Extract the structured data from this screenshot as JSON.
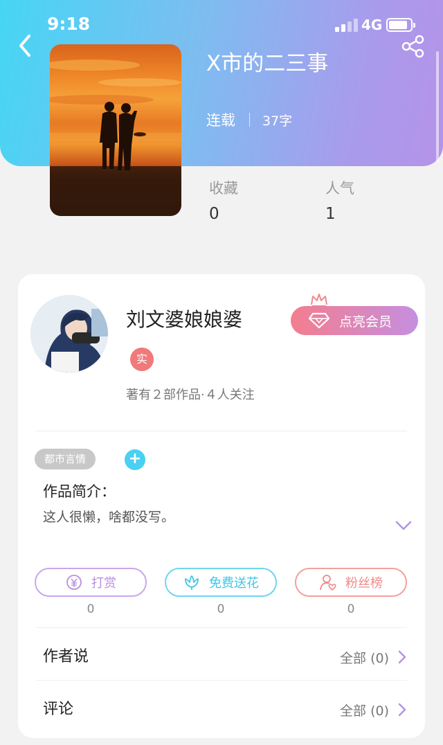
{
  "status_bar": {
    "time": "9:18",
    "network": "4G",
    "icons": [
      "signal-icon",
      "battery-icon"
    ]
  },
  "header": {
    "icons": [
      "back-icon",
      "share-icon"
    ],
    "title": "X市的二三事",
    "status": "连载",
    "word_count": "37字"
  },
  "stats": [
    {
      "label": "收藏",
      "value": "0"
    },
    {
      "label": "人气",
      "value": "1"
    }
  ],
  "author": {
    "name": "刘文婆娘娘婆",
    "badge": "实",
    "meta": "著有２部作品·４人关注",
    "vip_label": "点亮会员"
  },
  "intro": {
    "tag": "都市言情",
    "add_label": "+",
    "title": "作品简介：",
    "text": "这人很懒，啥都没写。"
  },
  "actions": [
    {
      "label": "打赏",
      "count": "0",
      "icon": "yen-coin-icon",
      "color": "#b98ee0"
    },
    {
      "label": "免费送花",
      "count": "0",
      "icon": "flower-icon",
      "color": "#3fc6e6"
    },
    {
      "label": "粉丝榜",
      "count": "0",
      "icon": "fan-heart-icon",
      "color": "#ef8a86"
    }
  ],
  "rows": [
    {
      "label": "作者说",
      "right": "全部 (0)"
    },
    {
      "label": "评论",
      "right": "全部 (0)"
    }
  ],
  "colors": {
    "header_gradient": [
      "#46d6f5",
      "#b593e8"
    ],
    "accent_purple": "#b98ee0",
    "accent_cyan": "#49d0f2",
    "badge_red": "#f0797a"
  }
}
